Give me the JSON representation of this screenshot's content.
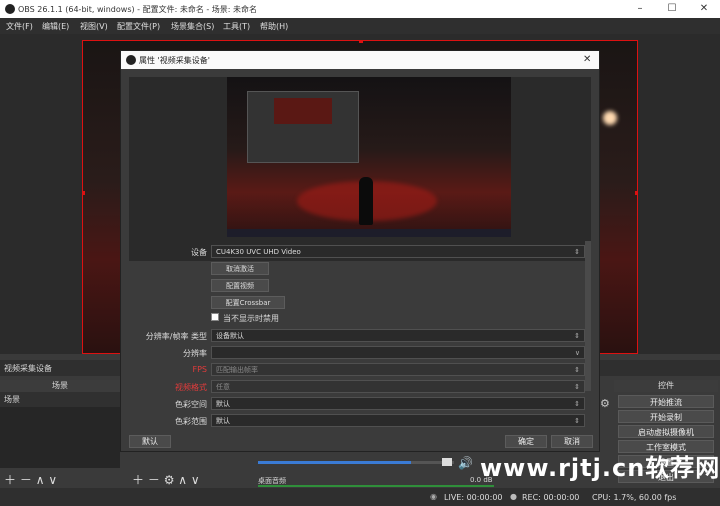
{
  "window": {
    "title": "OBS 26.1.1 (64-bit, windows) - 配置文件: 未命名 - 场景: 未命名",
    "controls": [
      "minimize-icon",
      "maximize-icon",
      "close-icon"
    ]
  },
  "menu": [
    "文件(F)",
    "编辑(E)",
    "视图(V)",
    "配置文件(P)",
    "场景集合(S)",
    "工具(T)",
    "帮助(H)"
  ],
  "source_label": "视频采集设备",
  "scenes": {
    "header": "场景",
    "items": [
      "场景"
    ]
  },
  "controls": {
    "header": "控件",
    "buttons": [
      "开始推流",
      "开始录制",
      "启动虚拟摄像机",
      "工作室模式",
      "设置",
      "退出"
    ]
  },
  "mixer": {
    "track_name": "桌面音频",
    "level": "0.0 dB",
    "volume_fraction": 0.78
  },
  "status": {
    "live": "LIVE: 00:00:00",
    "rec": "REC: 00:00:00",
    "cpu": "CPU: 1.7%, 60.00 fps"
  },
  "dialog": {
    "title": "属性 '视频采集设备'",
    "fields": {
      "device_label": "设备",
      "device_value": "CU4K30 UVC UHD Video",
      "deactivate_button": "取消激活",
      "configure_video_button": "配置视频",
      "configure_crossbar_button": "配置Crossbar",
      "deactivate_checkbox": "当不显示时禁用",
      "resolution_type_label": "分辨率/帧率 类型",
      "resolution_type_value": "设备默认",
      "resolution_label": "分辨率",
      "resolution_value": "",
      "fps_label": "FPS",
      "fps_value": "匹配输出帧率",
      "video_format_label": "视频格式",
      "video_format_value": "任意",
      "color_space_label": "色彩空间",
      "color_space_value": "默认",
      "color_range_label": "色彩范围",
      "color_range_value": "默认"
    },
    "defaults_button": "默认",
    "ok_button": "确定",
    "cancel_button": "取消"
  },
  "watermark": "www.rjtj.cn软荐网",
  "colors": {
    "accent_red": "#dd1111",
    "label_red": "#e23b3b",
    "meter_blue": "#3a7bd5"
  }
}
